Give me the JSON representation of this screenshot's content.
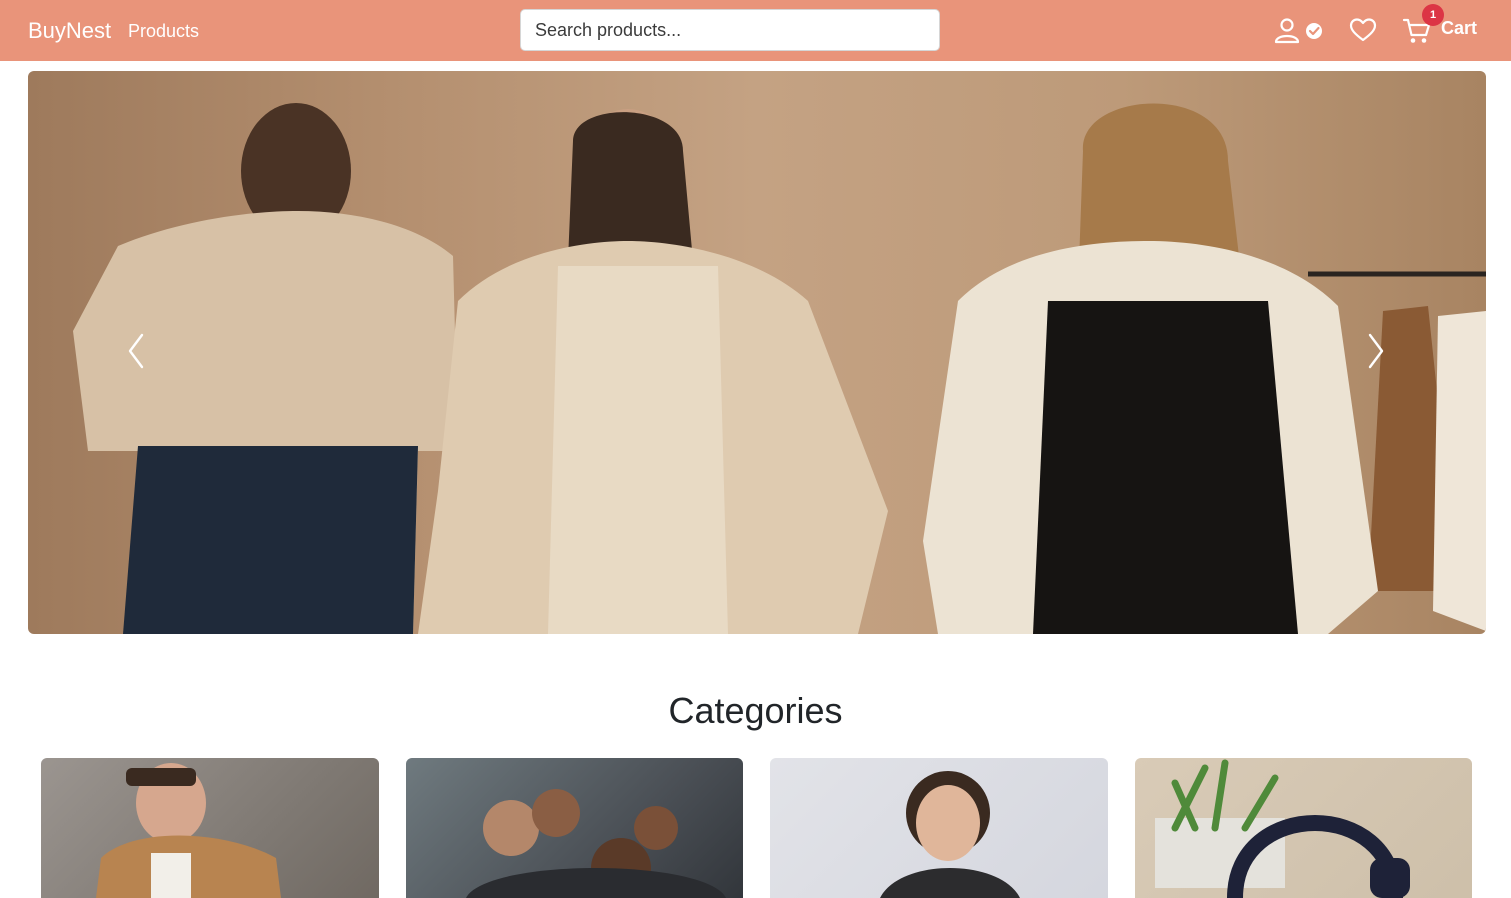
{
  "navbar": {
    "brand": "BuyNest",
    "products_link": "Products",
    "search_placeholder": "Search products...",
    "cart_label": "Cart",
    "cart_count": "1",
    "color": "#e9947a"
  },
  "hero": {
    "icons": {
      "prev": "chevron-left-icon",
      "next": "chevron-right-icon"
    }
  },
  "categories": {
    "title": "Categories",
    "cards": [
      {
        "icon": "category-image-men"
      },
      {
        "icon": "category-image-women"
      },
      {
        "icon": "category-image-kids"
      },
      {
        "icon": "category-image-electronics"
      }
    ]
  }
}
